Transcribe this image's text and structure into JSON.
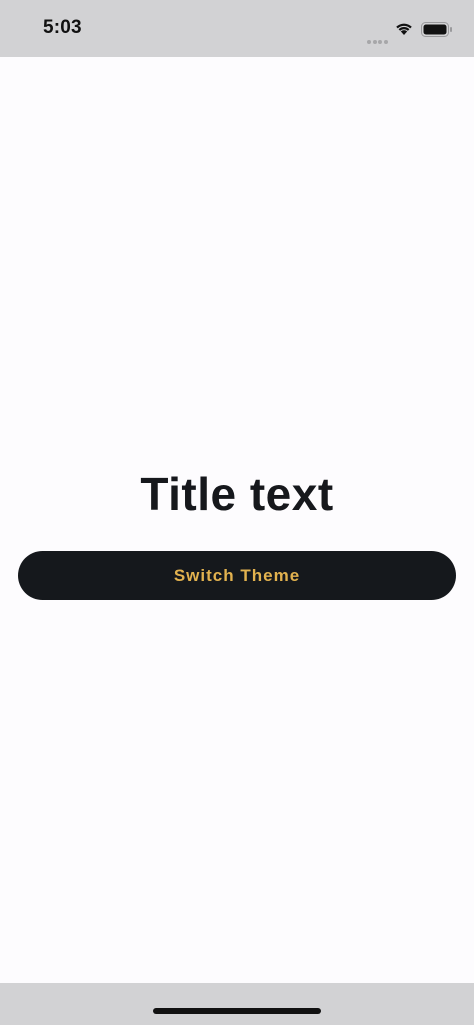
{
  "status_bar": {
    "time": "5:03",
    "icons": [
      "signal-dots-icon",
      "wifi-icon",
      "battery-icon"
    ]
  },
  "main": {
    "title": "Title text",
    "button_label": "Switch Theme"
  },
  "colors": {
    "background": "#fdfcfe",
    "bars": "#d2d2d4",
    "title": "#16181c",
    "button_bg": "#15181c",
    "button_text": "#e2b24f"
  }
}
